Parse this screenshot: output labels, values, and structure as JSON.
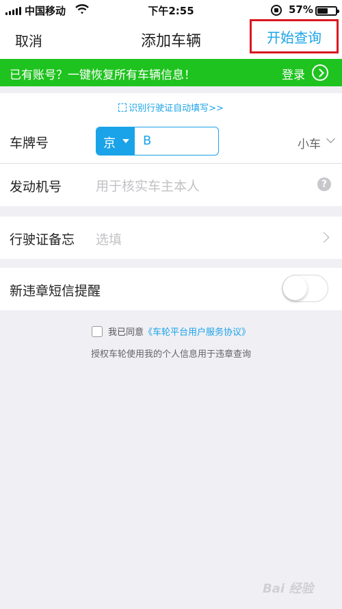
{
  "status_bar": {
    "carrier": "中国移动",
    "time": "下午2:55",
    "battery_percent": "57%",
    "battery_level": 0.57
  },
  "navbar": {
    "cancel_label": "取消",
    "title": "添加车辆",
    "query_label": "开始查询",
    "highlight_color": "#d9171f"
  },
  "banner": {
    "message": "已有账号？一键恢复所有车辆信息！",
    "login_label": "登录",
    "background": "#1fc31f"
  },
  "scan_link": "识别行驶证自动填写>>",
  "form": {
    "plate": {
      "label": "车牌号",
      "province": "京",
      "letter": "B",
      "car_type": "小车"
    },
    "engine": {
      "label": "发动机号",
      "placeholder": "用于核实车主本人",
      "help_icon": "?"
    },
    "license_memo": {
      "label": "行驶证备忘",
      "placeholder": "选填"
    },
    "sms_reminder": {
      "label": "新违章短信提醒",
      "enabled": false
    }
  },
  "agreement": {
    "prefix": "我已同意",
    "link": "《车轮平台用户服务协议》",
    "note": "授权车轮使用我的个人信息用于违章查询"
  },
  "theme": {
    "accent": "#1aa3e8",
    "background": "#efeff4"
  },
  "icons": [
    "signal-icon",
    "wifi-icon",
    "rotation-lock-icon",
    "battery-icon",
    "login-arrow-icon",
    "scan-icon",
    "chevron-down-icon",
    "help-icon",
    "chevron-right-icon"
  ]
}
